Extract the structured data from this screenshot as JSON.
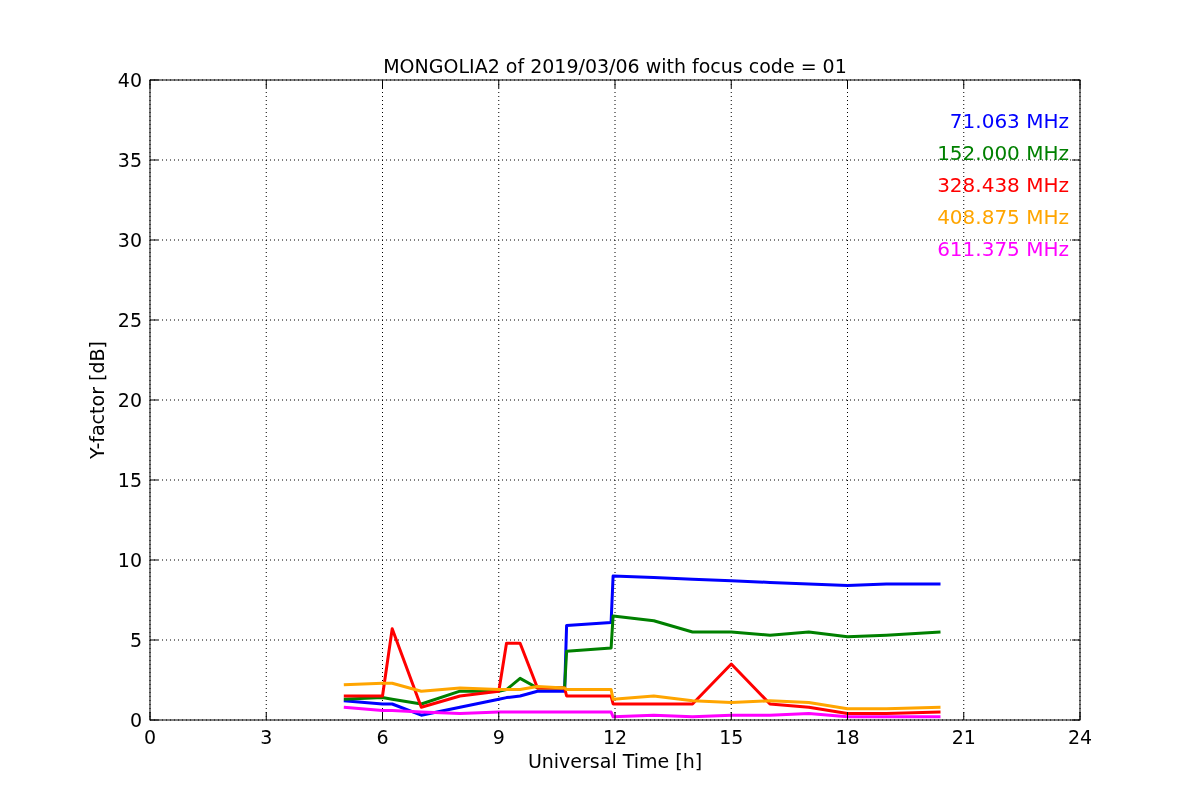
{
  "chart": {
    "chart_data": {
      "type": "line",
      "title": "MONGOLIA2 of 2019/03/06 with focus code = 01",
      "xlabel": "Universal Time [h]",
      "ylabel": "Y-factor [dB]",
      "x": [
        5,
        6,
        6.25,
        7,
        8,
        9,
        9.2,
        9.55,
        10,
        10.7,
        10.75,
        11.9,
        11.95,
        13,
        14,
        15,
        16,
        17,
        18,
        19,
        20.4
      ],
      "series": [
        {
          "name": "71.063 MHz",
          "color": "#0000ff",
          "values": [
            1.2,
            1.0,
            1.0,
            0.3,
            0.8,
            1.3,
            1.4,
            1.5,
            1.8,
            1.8,
            5.9,
            6.1,
            9.0,
            8.9,
            8.8,
            8.7,
            8.6,
            8.5,
            8.4,
            8.5,
            8.5
          ]
        },
        {
          "name": "152.000 MHz",
          "color": "#008000",
          "values": [
            1.3,
            1.4,
            1.3,
            1.0,
            1.8,
            1.8,
            1.9,
            2.6,
            2.0,
            2.0,
            4.3,
            4.5,
            6.5,
            6.2,
            5.5,
            5.5,
            5.3,
            5.5,
            5.2,
            5.3,
            5.5
          ]
        },
        {
          "name": "328.438 MHz",
          "color": "#ff0000",
          "values": [
            1.5,
            1.5,
            5.7,
            0.8,
            1.5,
            1.8,
            4.8,
            4.8,
            2.0,
            2.0,
            1.5,
            1.5,
            1.0,
            1.0,
            1.0,
            3.5,
            1.0,
            0.8,
            0.4,
            0.4,
            0.5
          ]
        },
        {
          "name": "408.875 MHz",
          "color": "#ffa500",
          "values": [
            2.2,
            2.3,
            2.3,
            1.8,
            2.0,
            1.9,
            1.9,
            1.9,
            2.1,
            2.0,
            1.9,
            1.9,
            1.3,
            1.5,
            1.2,
            1.1,
            1.2,
            1.1,
            0.7,
            0.7,
            0.8
          ]
        },
        {
          "name": "611.375 MHz",
          "color": "#ff00ff",
          "values": [
            0.8,
            0.6,
            0.6,
            0.5,
            0.4,
            0.5,
            0.5,
            0.5,
            0.5,
            0.5,
            0.5,
            0.5,
            0.2,
            0.3,
            0.2,
            0.3,
            0.3,
            0.4,
            0.2,
            0.2,
            0.2
          ]
        }
      ],
      "grid": true,
      "xlim": [
        0,
        24
      ],
      "ylim": [
        0,
        40
      ],
      "xticks": [
        0,
        3,
        6,
        9,
        12,
        15,
        18,
        21,
        24
      ],
      "yticks": [
        0,
        5,
        10,
        15,
        20,
        25,
        30,
        35,
        40
      ]
    }
  }
}
